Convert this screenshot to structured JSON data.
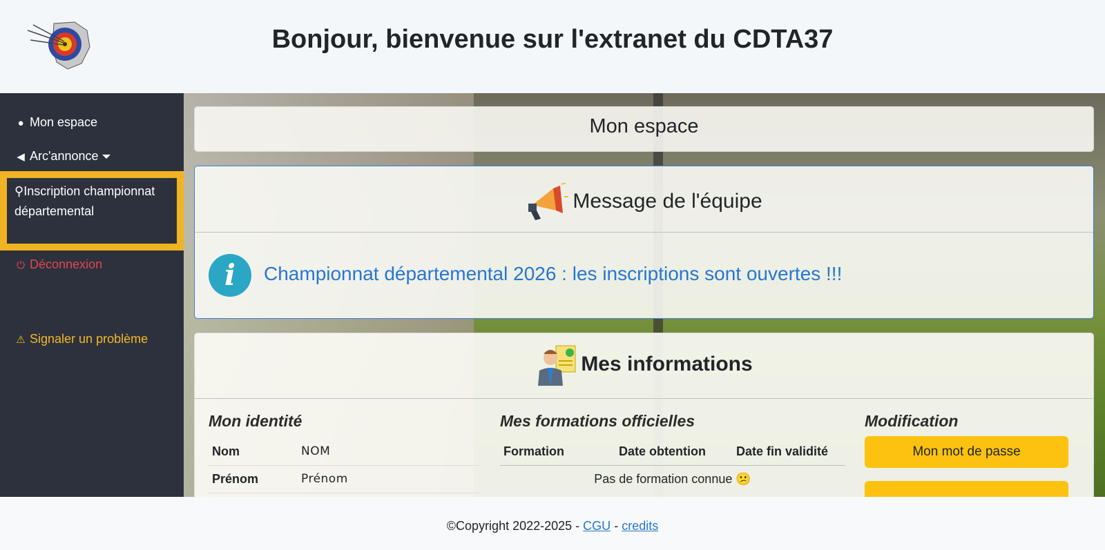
{
  "header": {
    "title": "Bonjour, bienvenue sur l'extranet du CDTA37"
  },
  "sidebar": {
    "items": [
      {
        "label": "Mon espace",
        "icon": "user-head-icon"
      },
      {
        "label": "Arc'annonce",
        "icon": "megaphone-icon"
      },
      {
        "label": "Inscription championnat départemental",
        "icon": "medal-icon"
      },
      {
        "label": "Déconnexion",
        "icon": "power-icon"
      },
      {
        "label": "Signaler un problème",
        "icon": "warning-icon"
      }
    ]
  },
  "main": {
    "espace_title": "Mon espace",
    "message": {
      "title": "Message de l'équipe",
      "text": "Championnat départemental 2026 : les inscriptions sont ouvertes !!!"
    },
    "infos": {
      "title": "Mes informations",
      "identity": {
        "title": "Mon identité",
        "rows": [
          {
            "key": "Nom",
            "value": "NOM"
          },
          {
            "key": "Prénom",
            "value": "Prénom"
          }
        ]
      },
      "formations": {
        "title": "Mes formations officielles",
        "columns": [
          "Formation",
          "Date obtention",
          "Date fin validité"
        ],
        "empty": "Pas de formation connue 😕"
      },
      "modification": {
        "title": "Modification",
        "password_button": "Mon mot de passe"
      }
    }
  },
  "footer": {
    "copyright": "©Copyright 2022-2025 -",
    "cgu": "CGU",
    "sep": "-",
    "credits": "credits"
  },
  "colors": {
    "sidebar_bg": "#2d313d",
    "highlight": "#f0b322",
    "logout": "#e04750",
    "report": "#f2b925",
    "link": "#2677d1",
    "button": "#fdc20f"
  }
}
